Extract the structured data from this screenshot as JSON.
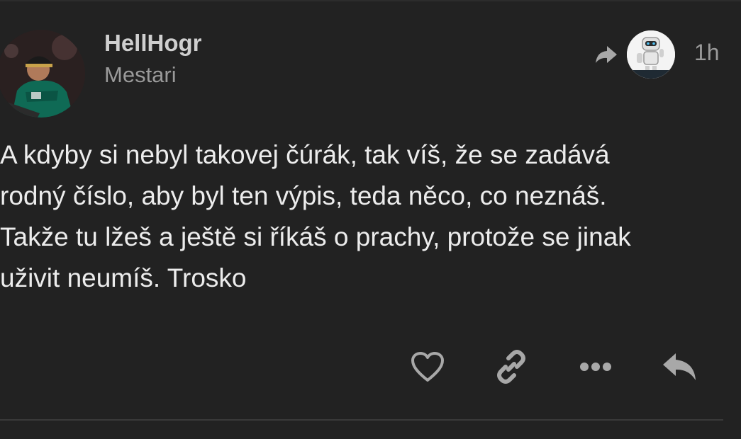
{
  "post": {
    "username": "HellHogr",
    "user_title": "Mestari",
    "time": "1h",
    "lines": [
      "A kdyby si nebyl takovej čúrák, tak víš, že se zadává",
      "rodný číslo, aby byl ten výpis, teda něco, co neznáš.",
      "Takže tu lžeš a ještě si říkáš o prachy, protože se jinak",
      "uživit neumíš. Trosko"
    ]
  },
  "icons": {
    "reply_to": "reply-arrow-icon",
    "like": "heart-icon",
    "link": "link-icon",
    "more": "more-dots-icon",
    "reply": "reply-icon"
  },
  "colors": {
    "background": "#222222",
    "text": "#ececec",
    "muted": "#9a9a9a",
    "icon": "#a8a8a8"
  }
}
